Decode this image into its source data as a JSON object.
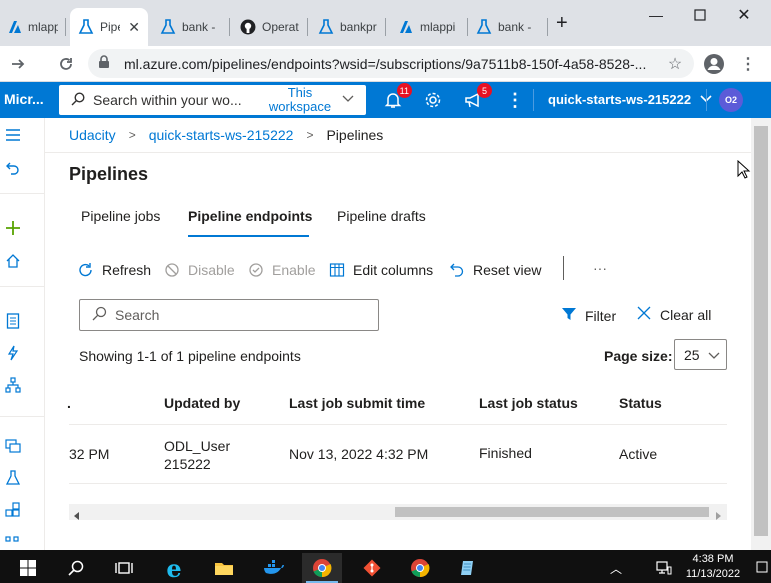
{
  "browser": {
    "tabs": [
      {
        "title": "mlappi",
        "active": false
      },
      {
        "title": "Pipe",
        "active": true
      },
      {
        "title": "bank -",
        "active": false
      },
      {
        "title": "Operat",
        "active": false
      },
      {
        "title": "bankpr",
        "active": false
      },
      {
        "title": "mlappi",
        "active": false
      },
      {
        "title": "bank -",
        "active": false
      }
    ],
    "new_tab": "+",
    "url": "ml.azure.com/pipelines/endpoints?wsid=/subscriptions/9a7511b8-150f-4a58-8528-..."
  },
  "azure_header": {
    "brand": "Micr...",
    "search_placeholder": "Search within your wo...",
    "scope_line1": "This",
    "scope_line2": "workspace",
    "notifications_count": "11",
    "feedback_count": "5",
    "workspace": "quick-starts-ws-215222",
    "avatar_initials": "O2"
  },
  "breadcrumb": [
    "Udacity",
    "quick-starts-ws-215222",
    "Pipelines"
  ],
  "page_title": "Pipelines",
  "tabs": [
    "Pipeline jobs",
    "Pipeline endpoints",
    "Pipeline drafts"
  ],
  "toolbar": {
    "refresh": "Refresh",
    "disable": "Disable",
    "enable": "Enable",
    "edit_columns": "Edit columns",
    "reset_view": "Reset view",
    "more": "···"
  },
  "search_placeholder": "Search",
  "filter_label": "Filter",
  "clear_all_label": "Clear all",
  "showing_text": "Showing 1-1 of 1 pipeline endpoints",
  "page_size_label": "Page size:",
  "page_size_value": "25",
  "grid": {
    "columns": [
      ".",
      "Updated by",
      "Last job submit time",
      "Last job status",
      "Status"
    ],
    "rows": [
      {
        "col0": "32 PM",
        "updated_by_1": "ODL_User",
        "updated_by_2": "215222",
        "last_submit": "Nov 13, 2022 4:32 PM",
        "last_status": "Finished",
        "status": "Active"
      }
    ]
  },
  "taskbar": {
    "time": "4:38 PM",
    "date": "11/13/2022"
  },
  "colors": {
    "accent": "#0078d4",
    "notification_badge": "#e81123",
    "taskbar": "#101010"
  }
}
